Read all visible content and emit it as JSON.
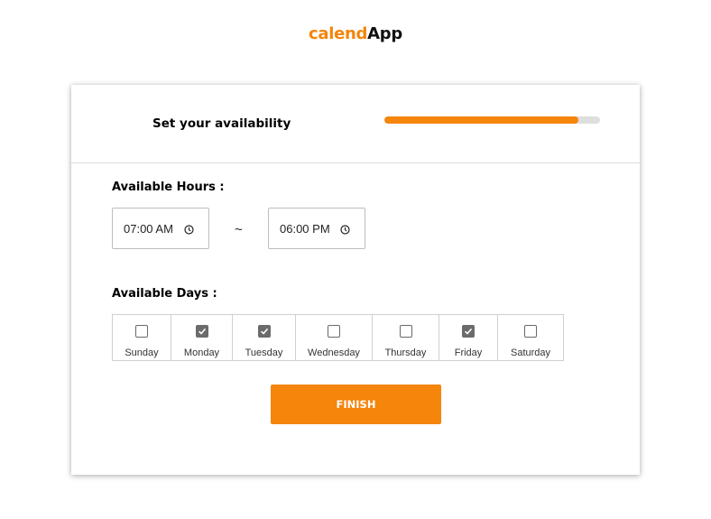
{
  "app": {
    "brand_part1": "calend",
    "brand_part2": "App",
    "accent_color": "#f5850b"
  },
  "header": {
    "step_title": "Set your availability",
    "progress": 0.9
  },
  "hours": {
    "label": "Available Hours :",
    "start": "07:00 AM",
    "separator": "~",
    "end": "06:00 PM",
    "icon": "clock-icon"
  },
  "days": {
    "label": "Available Days :",
    "items": [
      {
        "label": "Sunday",
        "checked": false
      },
      {
        "label": "Monday",
        "checked": true
      },
      {
        "label": "Tuesday",
        "checked": true
      },
      {
        "label": "Wednesday",
        "checked": false
      },
      {
        "label": "Thursday",
        "checked": false
      },
      {
        "label": "Friday",
        "checked": true
      },
      {
        "label": "Saturday",
        "checked": false
      }
    ]
  },
  "actions": {
    "finish_label": "FINISH"
  }
}
